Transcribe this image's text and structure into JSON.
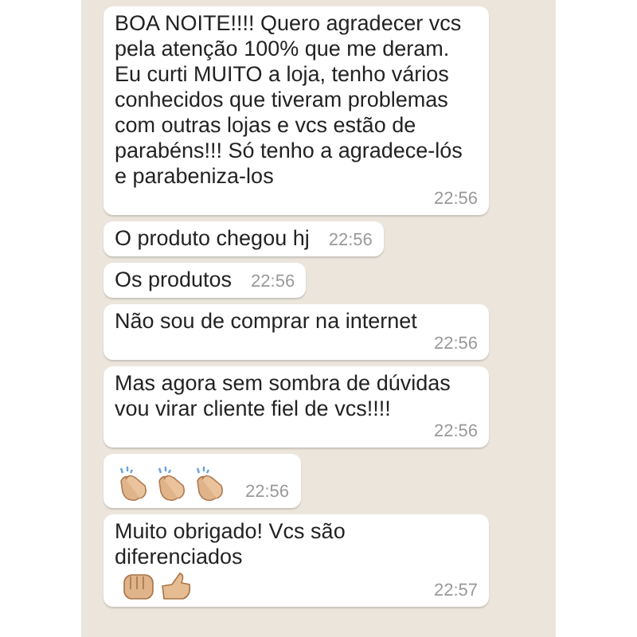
{
  "messages": [
    {
      "kind": "text",
      "text": "BOA NOITE!!!! Quero agradecer vcs pela atenção 100% que me deram. Eu curti MUITO a loja, tenho vários conhecidos que tiveram problemas com outras lojas e vcs estão de parabéns!!! Só tenho a agradece-lós e parabeniza-los",
      "time": "22:56"
    },
    {
      "kind": "text",
      "text": "O produto chegou hj",
      "time": "22:56"
    },
    {
      "kind": "text",
      "text": "Os produtos",
      "time": "22:56"
    },
    {
      "kind": "text",
      "text": "Não sou de comprar na internet",
      "time": "22:56"
    },
    {
      "kind": "text",
      "text": "Mas agora sem sombra de dúvidas vou virar cliente fiel de vcs!!!!",
      "time": "22:56"
    },
    {
      "kind": "claps",
      "time": "22:56"
    },
    {
      "kind": "text_gestures",
      "text": "Muito obrigado! Vcs são diferenciados",
      "time": "22:57"
    }
  ]
}
